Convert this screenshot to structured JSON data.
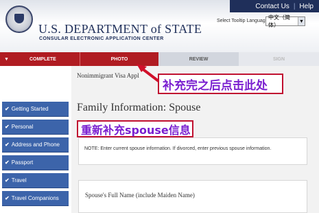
{
  "header": {
    "top_links": {
      "contact": "Contact Us",
      "separator": "|",
      "help": "Help"
    },
    "dept_title": "U.S. DEPARTMENT of STATE",
    "dept_subtitle": "CONSULAR ELECTRONIC APPLICATION CENTER",
    "tooltip_language_label": "Select Tooltip Language",
    "tooltip_language_value": "中文（简体）",
    "seal_icon": "us-department-of-state-seal-icon"
  },
  "tabs": {
    "complete": "COMPLETE",
    "photo": "PHOTO",
    "review": "REVIEW",
    "sign": "SIGN"
  },
  "sidebar": {
    "items": [
      {
        "label": "Getting Started"
      },
      {
        "label": "Personal"
      },
      {
        "label": "Address and Phone"
      },
      {
        "label": "Passport"
      },
      {
        "label": "Travel"
      },
      {
        "label": "Travel Companions"
      }
    ]
  },
  "main": {
    "page_path": "Nonimmigrant Visa Appl",
    "heading": "Family Information: Spouse",
    "note": "NOTE: Enter current spouse information. If divorced, enter previous spouse information.",
    "field_label": "Spouse's Full Name (include Maiden Name)"
  },
  "annotations": {
    "callout_1": "补充完之后点击此处",
    "callout_2": "重新补充spouse信息"
  },
  "colors": {
    "nav_red": "#b01c22",
    "sidebar_blue": "#3c64aa",
    "annotation_border": "#c01030",
    "annotation_text": "#7a1fd0"
  }
}
